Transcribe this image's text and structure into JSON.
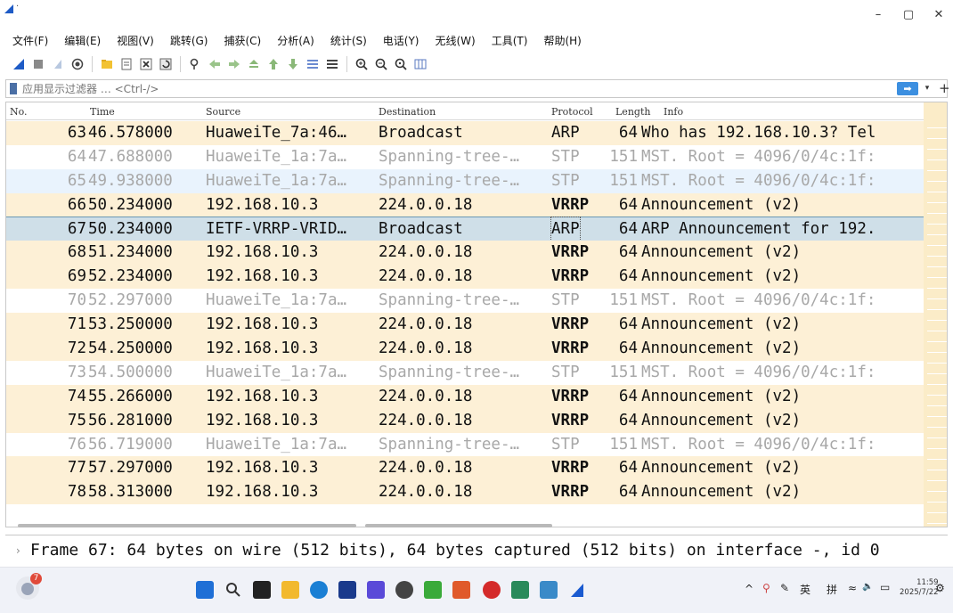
{
  "window": {
    "minimize": "–",
    "maximize": "▢",
    "close": "✕",
    "title_mark": "·"
  },
  "menu": [
    "文件(F)",
    "编辑(E)",
    "视图(V)",
    "跳转(G)",
    "捕获(C)",
    "分析(A)",
    "统计(S)",
    "电话(Y)",
    "无线(W)",
    "工具(T)",
    "帮助(H)"
  ],
  "toolbar_icons": [
    "shark-fin-start-icon",
    "stop-icon",
    "restart-icon",
    "options-icon",
    "open-file-icon",
    "save-file-icon",
    "close-file-icon",
    "reload-icon",
    "find-packet-icon",
    "go-back-icon",
    "go-forward-icon",
    "go-to-packet-icon",
    "first-packet-icon",
    "last-packet-icon",
    "autoscroll-icon",
    "colorize-icon",
    "zoom-in-icon",
    "zoom-out-icon",
    "zoom-normal-icon",
    "resize-columns-icon"
  ],
  "filter": {
    "placeholder": "应用显示过滤器 … <Ctrl-/>",
    "apply": "➡",
    "dropdown": "▾",
    "add": "+"
  },
  "columns": {
    "no": "No.",
    "time": "Time",
    "source": "Source",
    "destination": "Destination",
    "protocol": "Protocol",
    "length": "Length",
    "info": "Info"
  },
  "packets": [
    {
      "no": "63",
      "time": "46.578000",
      "src": "HuaweiTe_7a:46…",
      "dst": "Broadcast",
      "proto": "ARP",
      "len": "64",
      "info": "Who has 192.168.10.3? Tel",
      "style": "arp"
    },
    {
      "no": "64",
      "time": "47.688000",
      "src": "HuaweiTe_1a:7a…",
      "dst": "Spanning-tree-…",
      "proto": "STP",
      "len": "151",
      "info": "MST. Root = 4096/0/4c:1f:",
      "style": "stp"
    },
    {
      "no": "65",
      "time": "49.938000",
      "src": "HuaweiTe_1a:7a…",
      "dst": "Spanning-tree-…",
      "proto": "STP",
      "len": "151",
      "info": "MST. Root = 4096/0/4c:1f:",
      "style": "stp-blue"
    },
    {
      "no": "66",
      "time": "50.234000",
      "src": "192.168.10.3",
      "dst": "224.0.0.18",
      "proto": "VRRP",
      "len": "64",
      "info": "Announcement (v2)",
      "style": "vrrp"
    },
    {
      "no": "67",
      "time": "50.234000",
      "src": "IETF-VRRP-VRID…",
      "dst": "Broadcast",
      "proto": "ARP",
      "len": "64",
      "info": "ARP Announcement for 192.",
      "style": "selected"
    },
    {
      "no": "68",
      "time": "51.234000",
      "src": "192.168.10.3",
      "dst": "224.0.0.18",
      "proto": "VRRP",
      "len": "64",
      "info": "Announcement (v2)",
      "style": "vrrp"
    },
    {
      "no": "69",
      "time": "52.234000",
      "src": "192.168.10.3",
      "dst": "224.0.0.18",
      "proto": "VRRP",
      "len": "64",
      "info": "Announcement (v2)",
      "style": "vrrp"
    },
    {
      "no": "70",
      "time": "52.297000",
      "src": "HuaweiTe_1a:7a…",
      "dst": "Spanning-tree-…",
      "proto": "STP",
      "len": "151",
      "info": "MST. Root = 4096/0/4c:1f:",
      "style": "stp"
    },
    {
      "no": "71",
      "time": "53.250000",
      "src": "192.168.10.3",
      "dst": "224.0.0.18",
      "proto": "VRRP",
      "len": "64",
      "info": "Announcement (v2)",
      "style": "vrrp"
    },
    {
      "no": "72",
      "time": "54.250000",
      "src": "192.168.10.3",
      "dst": "224.0.0.18",
      "proto": "VRRP",
      "len": "64",
      "info": "Announcement (v2)",
      "style": "vrrp"
    },
    {
      "no": "73",
      "time": "54.500000",
      "src": "HuaweiTe_1a:7a…",
      "dst": "Spanning-tree-…",
      "proto": "STP",
      "len": "151",
      "info": "MST. Root = 4096/0/4c:1f:",
      "style": "stp"
    },
    {
      "no": "74",
      "time": "55.266000",
      "src": "192.168.10.3",
      "dst": "224.0.0.18",
      "proto": "VRRP",
      "len": "64",
      "info": "Announcement (v2)",
      "style": "vrrp"
    },
    {
      "no": "75",
      "time": "56.281000",
      "src": "192.168.10.3",
      "dst": "224.0.0.18",
      "proto": "VRRP",
      "len": "64",
      "info": "Announcement (v2)",
      "style": "vrrp"
    },
    {
      "no": "76",
      "time": "56.719000",
      "src": "HuaweiTe_1a:7a…",
      "dst": "Spanning-tree-…",
      "proto": "STP",
      "len": "151",
      "info": "MST. Root = 4096/0/4c:1f:",
      "style": "stp"
    },
    {
      "no": "77",
      "time": "57.297000",
      "src": "192.168.10.3",
      "dst": "224.0.0.18",
      "proto": "VRRP",
      "len": "64",
      "info": "Announcement (v2)",
      "style": "vrrp"
    },
    {
      "no": "78",
      "time": "58.313000",
      "src": "192.168.10.3",
      "dst": "224.0.0.18",
      "proto": "VRRP",
      "len": "64",
      "info": "Announcement (v2)",
      "style": "vrrp"
    }
  ],
  "row_colors": {
    "arp": "#fdf0d6",
    "vrrp": "#fdf0d6",
    "stp": "#ffffff",
    "stp-blue": "#e9f3fd",
    "selected": "#cfdfe8"
  },
  "detail": {
    "arrow": "›",
    "text": "Frame 67: 64 bytes on wire (512 bits), 64 bytes captured (512 bits) on interface -, id 0"
  },
  "taskbar": {
    "weather_badge": "7",
    "apps": [
      "windows-start-icon",
      "search-icon",
      "task-view-icon",
      "file-explorer-icon",
      "edge-browser-icon",
      "store-icon",
      "vscode-like-icon",
      "obs-icon",
      "wechat-icon",
      "pdf-icon",
      "record-icon",
      "editor-icon",
      "ensp-icon",
      "wireshark-icon"
    ],
    "app_colors": [
      "#1f6fd6",
      "#333333",
      "#222222",
      "#f2b92e",
      "#1a7fd4",
      "#1a3a8c",
      "#5a4ad8",
      "#444444",
      "#3aaa3a",
      "#e05a2a",
      "#d42a2a",
      "#2a8a5a",
      "#3a8ac8",
      "#1a5ad0"
    ],
    "tray_chevron": "^",
    "tray_ime_en": "英",
    "tray_ime_pin": "拼",
    "tray_net": "≈",
    "tray_vol": "🔈",
    "tray_batt": "▭",
    "time": "11:59",
    "date": "2025/7/22"
  }
}
